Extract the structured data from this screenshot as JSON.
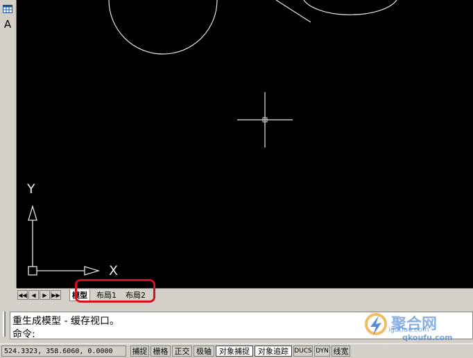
{
  "left_toolbar": {
    "text_tool_label": "A"
  },
  "canvas": {
    "ucs_labels": {
      "x": "X",
      "y": "Y"
    }
  },
  "layout_tabs": {
    "nav_buttons": [
      "first",
      "prev",
      "next",
      "last"
    ],
    "tabs": [
      {
        "label": "模型",
        "active": true
      },
      {
        "label": "布局1",
        "active": false
      },
      {
        "label": "布局2",
        "active": false
      }
    ]
  },
  "command": {
    "history_line": "重生成模型 - 缓存视口。",
    "prompt": "命令:"
  },
  "status_bar": {
    "coordinates": "524.3323,  358.6060,  0.0000",
    "buttons": [
      {
        "label": "捕捉",
        "on": false
      },
      {
        "label": "栅格",
        "on": false
      },
      {
        "label": "正交",
        "on": false
      },
      {
        "label": "极轴",
        "on": false
      },
      {
        "label": "对象捕捉",
        "on": true
      },
      {
        "label": "对象追踪",
        "on": true
      },
      {
        "label": "DUCS",
        "on": false
      },
      {
        "label": "DYN",
        "on": false
      },
      {
        "label": "线宽",
        "on": false
      }
    ]
  },
  "watermark": {
    "brand": "聚合网",
    "url": "qkoufu.com",
    "alt_url": "igatiao.com"
  },
  "colors": {
    "canvas_bg": "#000000",
    "highlight": "#d6101a",
    "ui_bg": "#d4d0c8"
  }
}
